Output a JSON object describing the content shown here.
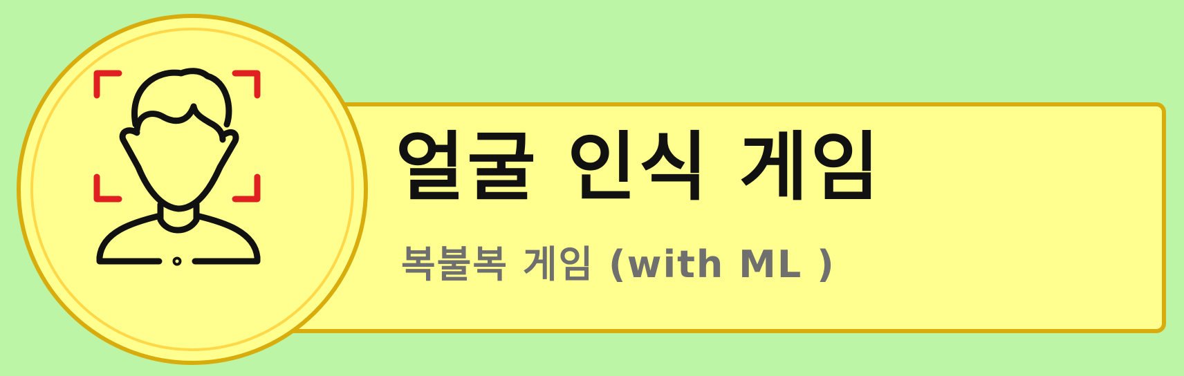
{
  "title": "얼굴 인식 게임",
  "subtitle": "복불복 게임 (with ML )",
  "icon": "face-recognition-icon",
  "colors": {
    "background": "#bcf5a6",
    "panel": "#ffff8f",
    "border": "#d9ac0d",
    "inner_ring": "#ffd84a",
    "title_text": "#111111",
    "subtitle_text": "#6f6f6f",
    "focus_corners": "#e02020"
  }
}
